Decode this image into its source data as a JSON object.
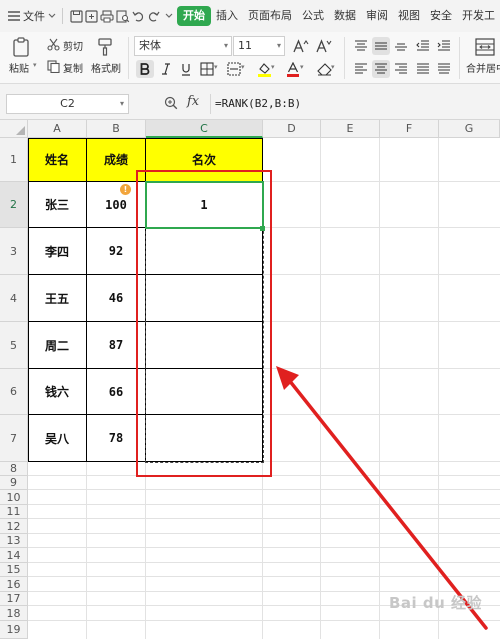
{
  "menubar": {
    "file_label": "文件",
    "tabs": [
      {
        "label": "开始",
        "active": true
      },
      {
        "label": "插入",
        "active": false
      },
      {
        "label": "页面布局",
        "active": false
      },
      {
        "label": "公式",
        "active": false
      },
      {
        "label": "数据",
        "active": false
      },
      {
        "label": "审阅",
        "active": false
      },
      {
        "label": "视图",
        "active": false
      },
      {
        "label": "安全",
        "active": false
      },
      {
        "label": "开发工",
        "active": false
      }
    ]
  },
  "ribbon": {
    "paste_label": "粘贴",
    "cut_label": "剪切",
    "copy_label": "复制",
    "format_painter_label": "格式刷",
    "font_name": "宋体",
    "font_size": "11",
    "merge_label": "合并居中"
  },
  "formula_bar": {
    "cell_ref": "C2",
    "fx_label": "fx",
    "formula": "=RANK(B2,B:B)"
  },
  "columns": [
    "A",
    "B",
    "C",
    "D",
    "E",
    "F",
    "G"
  ],
  "rows": [
    "1",
    "2",
    "3",
    "4",
    "5",
    "6",
    "7",
    "8",
    "9",
    "10",
    "11",
    "12",
    "13",
    "14",
    "15",
    "16",
    "17",
    "18",
    "19"
  ],
  "table": {
    "headers": [
      "姓名",
      "成绩",
      "名次"
    ],
    "rows": [
      {
        "name": "张三",
        "score": "100",
        "rank": "1"
      },
      {
        "name": "李四",
        "score": "92",
        "rank": ""
      },
      {
        "name": "王五",
        "score": "46",
        "rank": ""
      },
      {
        "name": "周二",
        "score": "87",
        "rank": ""
      },
      {
        "name": "钱六",
        "score": "66",
        "rank": ""
      },
      {
        "name": "吴八",
        "score": "78",
        "rank": ""
      }
    ]
  },
  "selection": {
    "active_cell": "C2",
    "copy_range": "C2:C7"
  },
  "colors": {
    "accent": "#2fa84f",
    "header_fill": "#ffff00",
    "annotation": "#e0201f",
    "warning": "#f2a53c"
  },
  "warning_glyph": "!",
  "watermark": "Bai du 经验"
}
